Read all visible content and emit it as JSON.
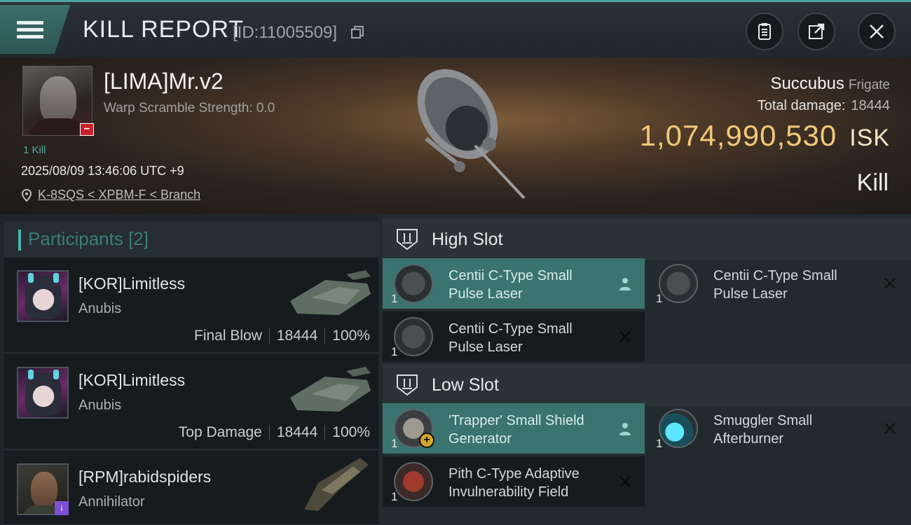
{
  "header": {
    "title": "KILL REPORT",
    "report_id": "[ID:11005509]"
  },
  "victim": {
    "name": "[LIMA]Mr.v2",
    "warp_scramble": "Warp Scramble Strength: 0.0",
    "kills": "1 Kill",
    "timestamp": "2025/08/09 13:46:06 UTC +9",
    "location": "K-8SQS < XPBM-F < Branch",
    "ship_name": "Succubus",
    "ship_class": "Frigate",
    "total_damage_label": "Total damage:",
    "total_damage_value": "18444",
    "isk_value": "1,074,990,530",
    "isk_unit": "ISK",
    "result": "Kill",
    "badge": "–"
  },
  "participants": {
    "heading": "Participants [2]",
    "rows": [
      {
        "name": "[KOR]Limitless",
        "ship": "Anubis",
        "role": "Final Blow",
        "damage": "18444",
        "percent": "100%"
      },
      {
        "name": "[KOR]Limitless",
        "ship": "Anubis",
        "role": "Top Damage",
        "damage": "18444",
        "percent": "100%"
      },
      {
        "name": "[RPM]rabidspiders",
        "ship": "Annihilator",
        "badge": "i"
      }
    ]
  },
  "fitting": {
    "high_slot_label": "High Slot",
    "low_slot_label": "Low Slot",
    "high_modules": [
      {
        "name": "Centii C-Type Small Pulse Laser",
        "qty": "1",
        "state": "dropped"
      },
      {
        "name": "Centii C-Type Small Pulse Laser",
        "qty": "1",
        "state": "destroyed"
      },
      {
        "name": "Centii C-Type Small Pulse Laser",
        "qty": "1",
        "state": "destroyed"
      }
    ],
    "low_modules": [
      {
        "name": "'Trapper' Small Shield Generator",
        "qty": "1",
        "state": "dropped"
      },
      {
        "name": "Smuggler Small Afterburner",
        "qty": "1",
        "state": "destroyed"
      },
      {
        "name": "Pith C-Type Adaptive Invulnerability Field",
        "qty": "1",
        "state": "destroyed"
      }
    ]
  },
  "colors": {
    "accent_teal": "#4fa3a0",
    "isk_gold": "#f0c878",
    "active_row": "#3a7370",
    "victim_badge": "#c8202b"
  }
}
